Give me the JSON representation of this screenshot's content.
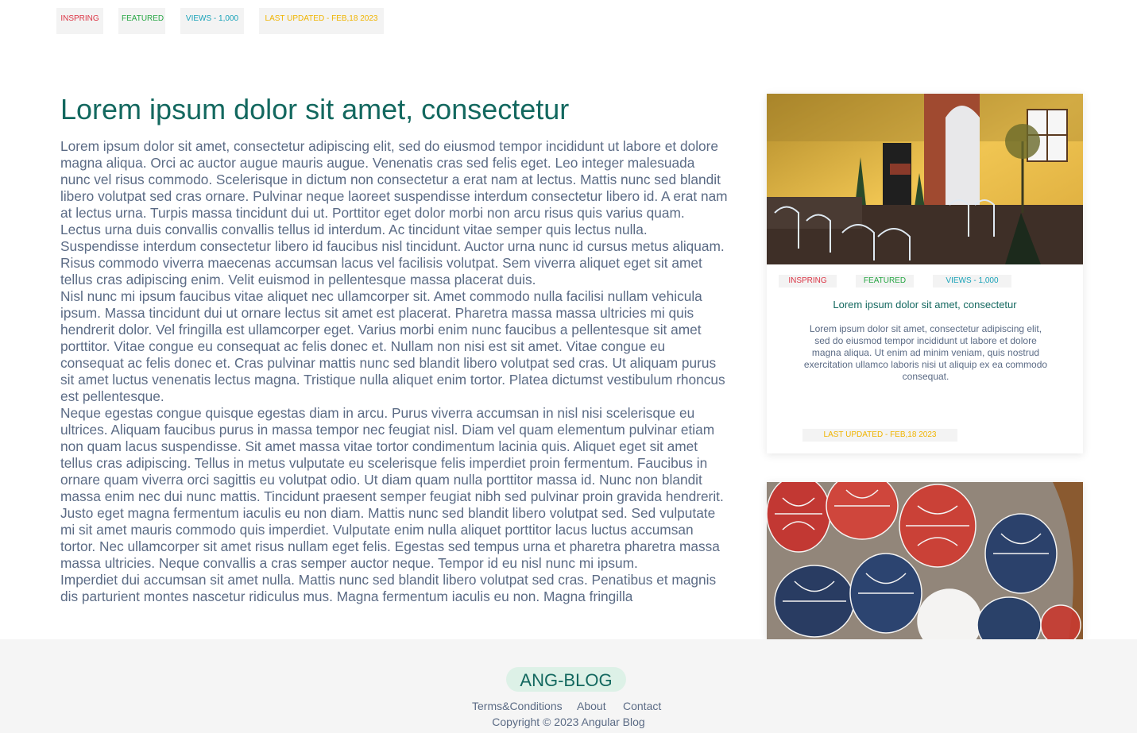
{
  "top_tags": {
    "inspiring": "INSPRING",
    "featured": "FEATURED",
    "views": "VIEWS - 1,000",
    "updated": "LAST UPDATED - FEB,18 2023"
  },
  "article": {
    "title": "Lorem ipsum dolor sit amet, consectetur",
    "paragraphs": [
      "Lorem ipsum dolor sit amet, consectetur adipiscing elit, sed do eiusmod tempor incididunt ut labore et dolore magna aliqua. Orci ac auctor augue mauris augue. Venenatis cras sed felis eget. Leo integer malesuada nunc vel risus commodo. Scelerisque in dictum non consectetur a erat nam at lectus. Mattis nunc sed blandit libero volutpat sed cras ornare. Pulvinar neque laoreet suspendisse interdum consectetur libero id. A erat nam at lectus urna. Turpis massa tincidunt dui ut. Porttitor eget dolor morbi non arcu risus quis varius quam. Lectus urna duis convallis convallis tellus id interdum. Ac tincidunt vitae semper quis lectus nulla. Suspendisse interdum consectetur libero id faucibus nisl tincidunt. Auctor urna nunc id cursus metus aliquam. Risus commodo viverra maecenas accumsan lacus vel facilisis volutpat. Sem viverra aliquet eget sit amet tellus cras adipiscing enim. Velit euismod in pellentesque massa placerat duis.",
      "Nisl nunc mi ipsum faucibus vitae aliquet nec ullamcorper sit. Amet commodo nulla facilisi nullam vehicula ipsum. Massa tincidunt dui ut ornare lectus sit amet est placerat. Pharetra massa massa ultricies mi quis hendrerit dolor. Vel fringilla est ullamcorper eget. Varius morbi enim nunc faucibus a pellentesque sit amet porttitor. Vitae congue eu consequat ac felis donec et. Nullam non nisi est sit amet. Vitae congue eu consequat ac felis donec et. Cras pulvinar mattis nunc sed blandit libero volutpat sed cras. Ut aliquam purus sit amet luctus venenatis lectus magna. Tristique nulla aliquet enim tortor. Platea dictumst vestibulum rhoncus est pellentesque.",
      "Neque egestas congue quisque egestas diam in arcu. Purus viverra accumsan in nisl nisi scelerisque eu ultrices. Aliquam faucibus purus in massa tempor nec feugiat nisl. Diam vel quam elementum pulvinar etiam non quam lacus suspendisse. Sit amet massa vitae tortor condimentum lacinia quis. Aliquet eget sit amet tellus cras adipiscing. Tellus in metus vulputate eu scelerisque felis imperdiet proin fermentum. Faucibus in ornare quam viverra orci sagittis eu volutpat odio. Ut diam quam nulla porttitor massa id. Nunc non blandit massa enim nec dui nunc mattis. Tincidunt praesent semper feugiat nibh sed pulvinar proin gravida hendrerit. Justo eget magna fermentum iaculis eu non diam. Mattis nunc sed blandit libero volutpat sed. Sed vulputate mi sit amet mauris commodo quis imperdiet. Vulputate enim nulla aliquet porttitor lacus luctus accumsan tortor. Nec ullamcorper sit amet risus nullam eget felis. Egestas sed tempus urna et pharetra pharetra massa massa ultricies. Neque convallis a cras semper auctor neque. Tempor id eu nisl nunc mi ipsum.",
      "Imperdiet dui accumsan sit amet nulla. Mattis nunc sed blandit libero volutpat sed cras. Penatibus et magnis dis parturient montes nascetur ridiculus mus. Magna fermentum iaculis eu non. Magna fringilla"
    ]
  },
  "card": {
    "tags": {
      "inspiring": "INSPRING",
      "featured": "FEATURED",
      "views": "VIEWS - 1,000",
      "updated": "LAST UPDATED - FEB,18 2023"
    },
    "title": "Lorem ipsum dolor sit amet, consectetur",
    "description": "Lorem ipsum dolor sit amet, consectetur adipiscing elit, sed do eiusmod tempor incididunt ut labore et dolore magna aliqua. Ut enim ad minim veniam, quis nostrud exercitation ullamco laboris nisi ut aliquip ex ea commodo consequat."
  },
  "footer": {
    "brand": "ANG-BLOG",
    "links": [
      "Terms&Conditions",
      "About",
      "Contact"
    ],
    "copyright": "Copyright © 2023 Angular Blog"
  },
  "colors": {
    "accent": "#13685f",
    "body_text": "#5b6b85",
    "tag_red": "#dc3545",
    "tag_green": "#28a745",
    "tag_cyan": "#17a2b8",
    "tag_yellow": "#f0b400"
  }
}
